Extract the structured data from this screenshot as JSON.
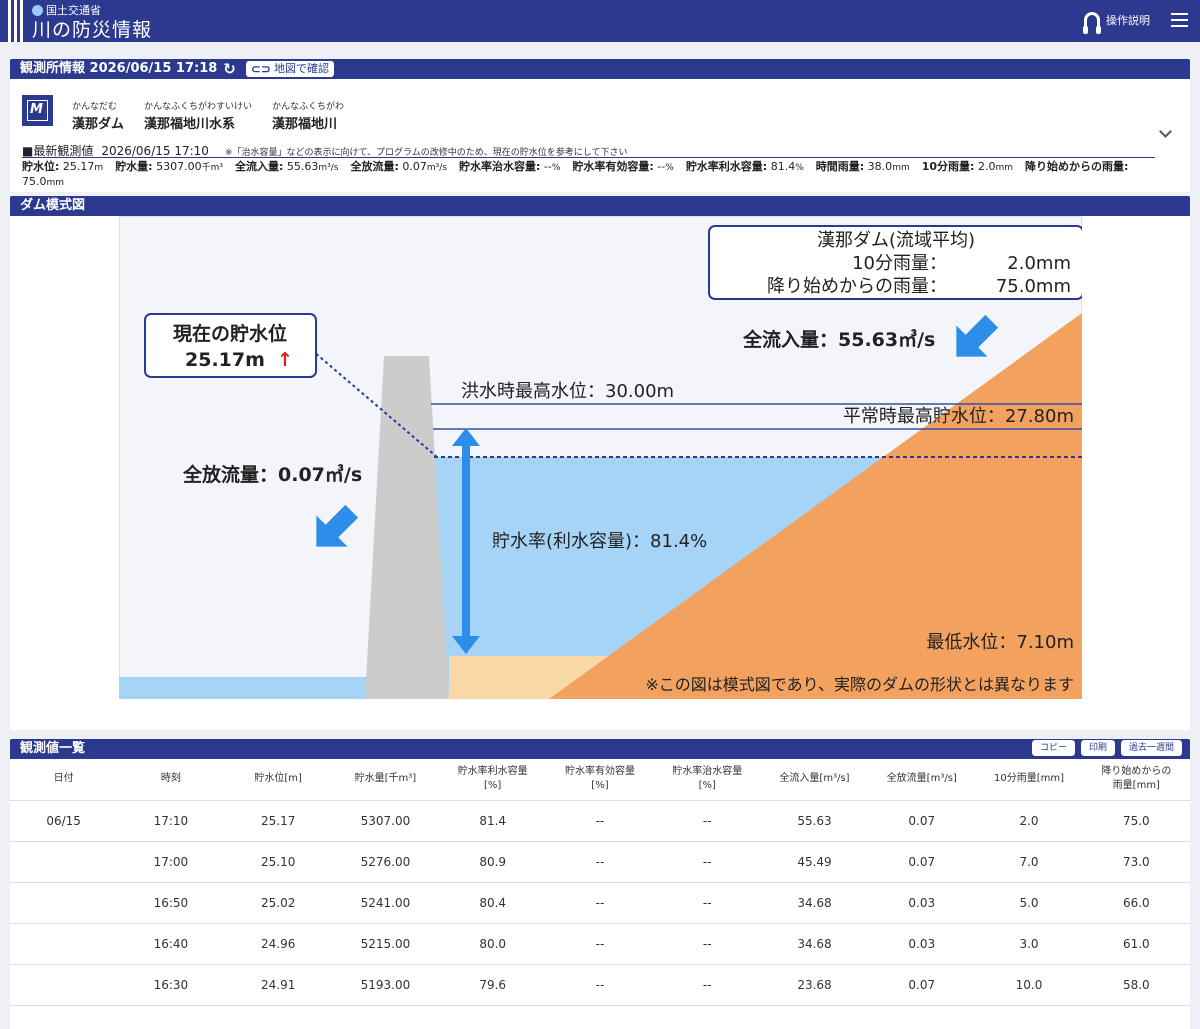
{
  "header": {
    "org": "国土交通省",
    "site_title": "川の防災情報",
    "help_label": "操作説明"
  },
  "station": {
    "section_title": "観測所情報 2026/06/15 17:18",
    "map_button": "地図で確認",
    "logo_text": "M",
    "names": [
      {
        "ruby": "かんなだむ",
        "name": "漢那ダム"
      },
      {
        "ruby": "かんなふくちがわすいけい",
        "name": "漢那福地川水系"
      },
      {
        "ruby": "かんなふくちがわ",
        "name": "漢那福地川"
      }
    ],
    "latest_label": "■最新観測値",
    "latest_time": "2026/06/15 17:10",
    "latest_note": "※「治水容量」などの表示に向けて、プログラムの改修中のため、現在の貯水位を参考にして下さい",
    "obs": [
      {
        "label": "貯水位:",
        "value": "25.17",
        "unit": "m"
      },
      {
        "label": "貯水量:",
        "value": "5307.00",
        "unit": "千m³"
      },
      {
        "label": "全流入量:",
        "value": "55.63",
        "unit": "m³/s"
      },
      {
        "label": "全放流量:",
        "value": "0.07",
        "unit": "m³/s"
      },
      {
        "label": "貯水率治水容量:",
        "value": "--",
        "unit": "%"
      },
      {
        "label": "貯水率有効容量:",
        "value": "--",
        "unit": "%"
      },
      {
        "label": "貯水率利水容量:",
        "value": "81.4",
        "unit": "%"
      },
      {
        "label": "時間雨量:",
        "value": "38.0",
        "unit": "mm"
      },
      {
        "label": "10分雨量:",
        "value": "2.0",
        "unit": "mm"
      },
      {
        "label": "降り始めからの雨量:",
        "value": "75.0",
        "unit": "mm"
      }
    ]
  },
  "dam": {
    "section_title": "ダム模式図",
    "rain_box_title": "漢那ダム(流域平均)",
    "rain_10min_label": "10分雨量：",
    "rain_10min_value": "2.0mm",
    "rain_total_label": "降り始めからの雨量：",
    "rain_total_value": "75.0mm",
    "current_level_title": "現在の貯水位",
    "current_level_value": "25.17m",
    "current_level_arrow": "↑",
    "inflow": "全流入量：55.63㎥/s",
    "outflow": "全放流量：0.07㎥/s",
    "flood_max_level": "洪水時最高水位：30.00m",
    "normal_max_level": "平常時最高貯水位：27.80m",
    "storage_rate": "貯水率(利水容量)：81.4%",
    "min_level": "最低水位：7.10m",
    "disclaimer": "※この図は模式図であり、実際のダムの形状とは異なります",
    "colors": {
      "water": "#a6d4f7",
      "land": "#f2a25e",
      "dam": "#cccccc",
      "sediment": "#f8d9a6",
      "arrow": "#2c8ee8",
      "frame": "#2b3a8f"
    }
  },
  "table": {
    "section_title": "観測値一覧",
    "buttons": [
      "コピー",
      "印刷",
      "過去一週間"
    ],
    "headers": [
      "日付",
      "時刻",
      "貯水位[m]",
      "貯水量[千m³]",
      "貯水率利水容量\n[%]",
      "貯水率有効容量\n[%]",
      "貯水率治水容量\n[%]",
      "全流入量[m³/s]",
      "全放流量[m³/s]",
      "10分雨量[mm]",
      "降り始めからの\n雨量[mm]"
    ],
    "rows": [
      [
        "06/15",
        "17:10",
        "25.17",
        "5307.00",
        "81.4",
        "--",
        "--",
        "55.63",
        "0.07",
        "2.0",
        "75.0"
      ],
      [
        "",
        "17:00",
        "25.10",
        "5276.00",
        "80.9",
        "--",
        "--",
        "45.49",
        "0.07",
        "7.0",
        "73.0"
      ],
      [
        "",
        "16:50",
        "25.02",
        "5241.00",
        "80.4",
        "--",
        "--",
        "34.68",
        "0.03",
        "5.0",
        "66.0"
      ],
      [
        "",
        "16:40",
        "24.96",
        "5215.00",
        "80.0",
        "--",
        "--",
        "34.68",
        "0.03",
        "3.0",
        "61.0"
      ],
      [
        "",
        "16:30",
        "24.91",
        "5193.00",
        "79.6",
        "--",
        "--",
        "23.68",
        "0.07",
        "10.0",
        "58.0"
      ],
      [
        "",
        "",
        "",
        "",
        "",
        "",
        "",
        "",
        "",
        "",
        ""
      ]
    ]
  }
}
